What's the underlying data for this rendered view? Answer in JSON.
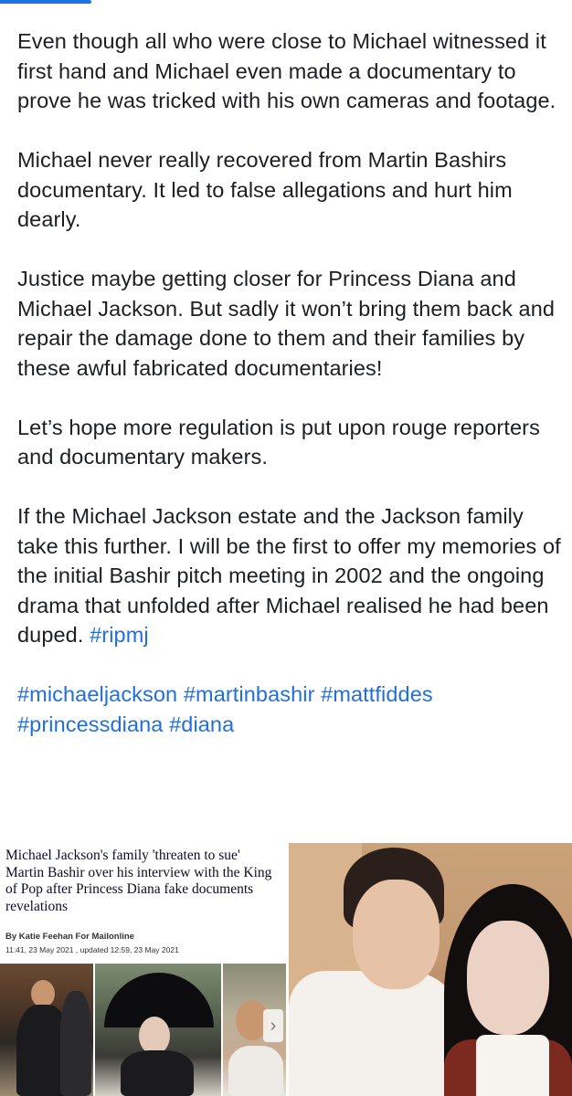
{
  "post": {
    "paragraphs": [
      "Even though all who were close to Michael witnessed it first hand and Michael even made a documentary to prove he was tricked with his own cameras and footage.",
      "Michael never really recovered from Martin Bashirs documentary. It led to false allegations and hurt him dearly.",
      "Justice maybe getting closer for Princess Diana and Michael Jackson. But sadly it won’t bring them back and repair the damage done to them and their families by these awful fabricated documentaries!",
      "Let’s hope more regulation is put upon rouge reporters and documentary makers."
    ],
    "last_paragraph": "If the Michael Jackson estate and the Jackson family take this further. I will be the first to offer my memories of the initial Bashir pitch meeting in 2002 and the ongoing drama that unfolded after Michael realised he had been duped. ",
    "inline_hashtag": "#ripmj",
    "hashtags_line1": "#michaeljackson #martinbashir #mattfiddes",
    "hashtags_line2": "#princessdiana #diana"
  },
  "article_clip": {
    "headline": "Michael Jackson's family 'threaten to sue' Martin Bashir over his interview with the King of Pop after Princess Diana fake documents revelations",
    "byline": "By Katie Feehan For Mailonline",
    "dateline": "11:41, 23 May 2021 , updated 12:59, 23 May 2021",
    "next_icon": "chevron-right-icon"
  },
  "colors": {
    "text": "#1c1e21",
    "hashtag": "#216fdb",
    "indicator": "#1b74e4"
  }
}
